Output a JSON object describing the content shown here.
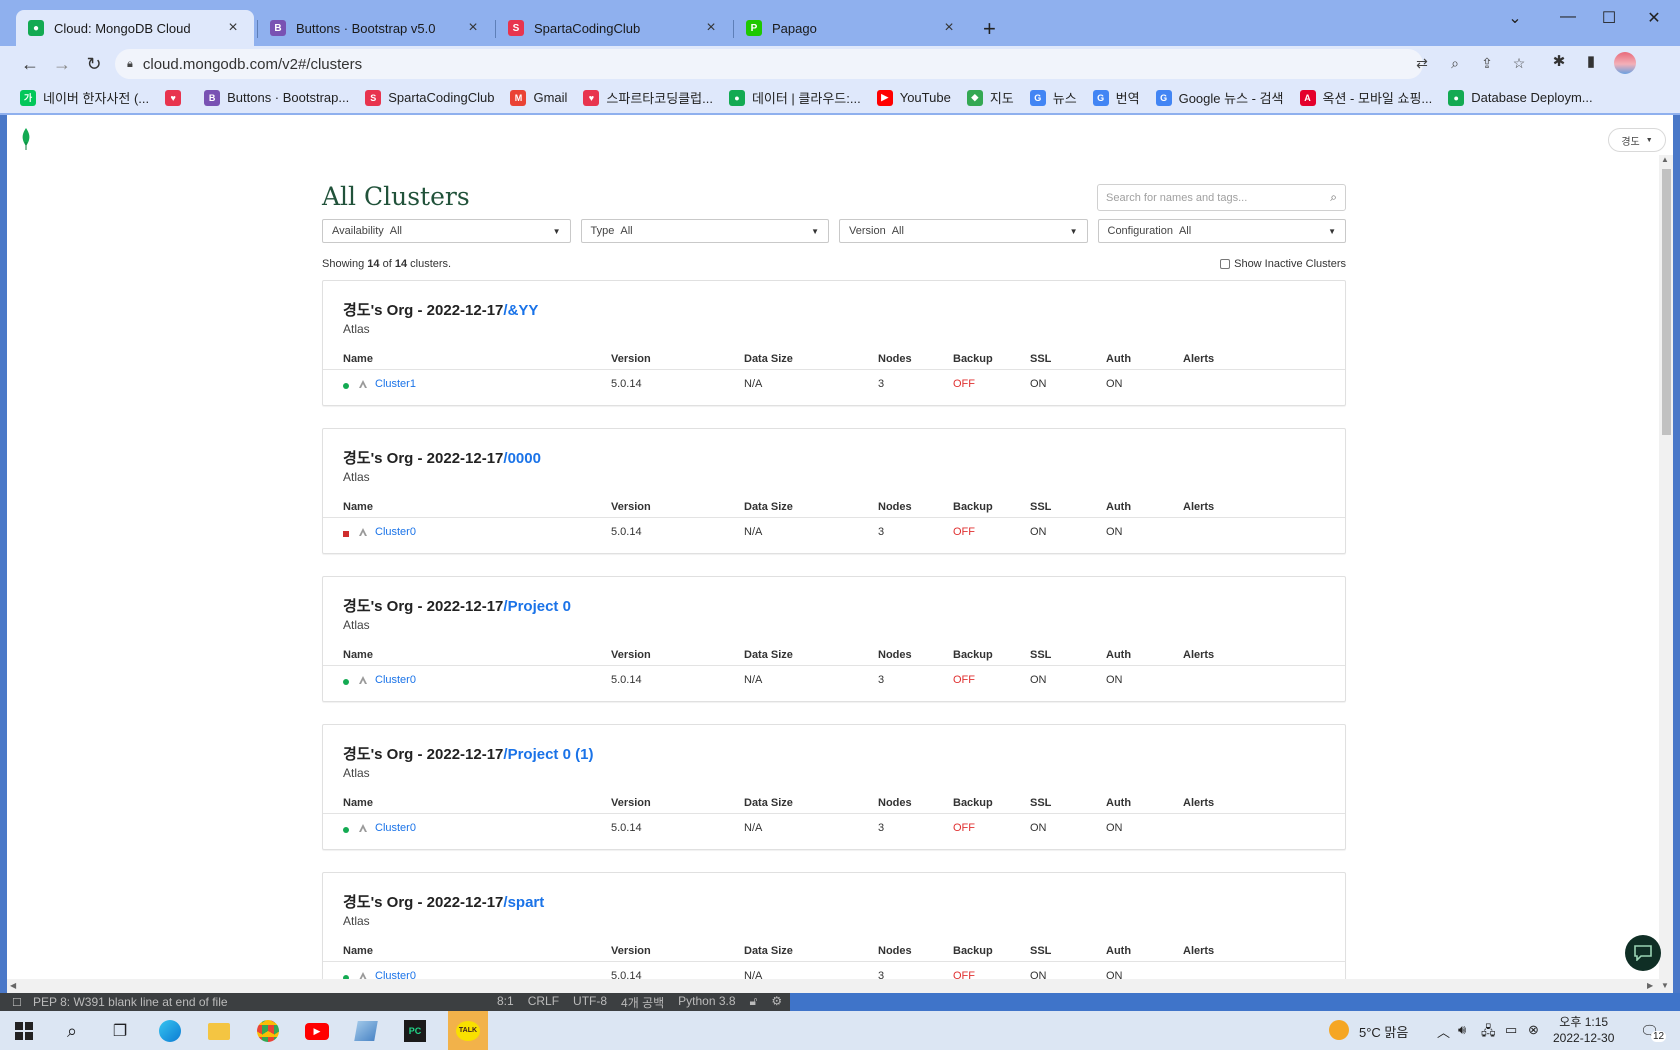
{
  "browser": {
    "tabs": [
      {
        "title": "Cloud: MongoDB Cloud",
        "favicon": "mongodb-leaf-icon",
        "color": "#13aa52",
        "active": true
      },
      {
        "title": "Buttons · Bootstrap v5.0",
        "favicon": "bootstrap-icon",
        "color": "#7952b3",
        "active": false
      },
      {
        "title": "SpartaCodingClub",
        "favicon": "sparta-icon",
        "color": "#e8344e",
        "active": false
      },
      {
        "title": "Papago",
        "favicon": "papago-icon",
        "color": "#1ec800",
        "active": false
      }
    ],
    "url": "cloud.mongodb.com/v2#/clusters",
    "bookmarks": [
      {
        "label": "네이버 한자사전 (...",
        "color": "#03c75a",
        "glyph": "가"
      },
      {
        "label": "",
        "color": "#e8344e",
        "glyph": "♥"
      },
      {
        "label": "Buttons · Bootstrap...",
        "color": "#7952b3",
        "glyph": "B"
      },
      {
        "label": "SpartaCodingClub",
        "color": "#e8344e",
        "glyph": "S"
      },
      {
        "label": "Gmail",
        "color": "#ea4335",
        "glyph": "M"
      },
      {
        "label": "스파르타코딩클럽...",
        "color": "#e8344e",
        "glyph": "♥"
      },
      {
        "label": "데이터 | 클라우드:...",
        "color": "#13aa52",
        "glyph": "●"
      },
      {
        "label": "YouTube",
        "color": "#ff0000",
        "glyph": "▶"
      },
      {
        "label": "지도",
        "color": "#34a853",
        "glyph": "◆"
      },
      {
        "label": "뉴스",
        "color": "#4285f4",
        "glyph": "G"
      },
      {
        "label": "번역",
        "color": "#4285f4",
        "glyph": "G"
      },
      {
        "label": "Google 뉴스 - 검색",
        "color": "#4285f4",
        "glyph": "G"
      },
      {
        "label": "옥션 - 모바일 쇼핑...",
        "color": "#e4002b",
        "glyph": "A"
      },
      {
        "label": "Database Deploym...",
        "color": "#13aa52",
        "glyph": "●"
      }
    ]
  },
  "page": {
    "user_menu": "경도",
    "title": "All Clusters",
    "search_placeholder": "Search for names and tags...",
    "filters": [
      {
        "label": "Availability",
        "value": "All"
      },
      {
        "label": "Type",
        "value": "All"
      },
      {
        "label": "Version",
        "value": "All"
      },
      {
        "label": "Configuration",
        "value": "All"
      }
    ],
    "showing_prefix": "Showing",
    "showing_count": "14",
    "showing_of": "of",
    "showing_total": "14",
    "showing_suffix": "clusters.",
    "show_inactive_label": "Show Inactive Clusters",
    "columns": [
      "Name",
      "Version",
      "Data Size",
      "Nodes",
      "Backup",
      "SSL",
      "Auth",
      "Alerts"
    ],
    "status_colors": {
      "active": "#13aa52",
      "paused": "#cf2e2e",
      "off": "#e03131"
    },
    "groups": [
      {
        "org": "경도's Org - 2022-12-17",
        "project": "/&YY",
        "type": "Atlas",
        "cluster": {
          "status": "active",
          "name": "Cluster1",
          "version": "5.0.14",
          "data_size": "N/A",
          "nodes": "3",
          "backup": "OFF",
          "ssl": "ON",
          "auth": "ON",
          "alerts": ""
        }
      },
      {
        "org": "경도's Org - 2022-12-17",
        "project": "/0000",
        "type": "Atlas",
        "cluster": {
          "status": "paused",
          "name": "Cluster0",
          "version": "5.0.14",
          "data_size": "N/A",
          "nodes": "3",
          "backup": "OFF",
          "ssl": "ON",
          "auth": "ON",
          "alerts": ""
        }
      },
      {
        "org": "경도's Org - 2022-12-17",
        "project": "/Project 0",
        "type": "Atlas",
        "cluster": {
          "status": "active",
          "name": "Cluster0",
          "version": "5.0.14",
          "data_size": "N/A",
          "nodes": "3",
          "backup": "OFF",
          "ssl": "ON",
          "auth": "ON",
          "alerts": ""
        }
      },
      {
        "org": "경도's Org - 2022-12-17",
        "project": "/Project 0 (1)",
        "type": "Atlas",
        "cluster": {
          "status": "active",
          "name": "Cluster0",
          "version": "5.0.14",
          "data_size": "N/A",
          "nodes": "3",
          "backup": "OFF",
          "ssl": "ON",
          "auth": "ON",
          "alerts": ""
        }
      },
      {
        "org": "경도's Org - 2022-12-17",
        "project": "/spart",
        "type": "Atlas",
        "cluster": {
          "status": "active",
          "name": "Cluster0",
          "version": "5.0.14",
          "data_size": "N/A",
          "nodes": "3",
          "backup": "OFF",
          "ssl": "ON",
          "auth": "ON",
          "alerts": ""
        }
      }
    ]
  },
  "ide_status": {
    "message": "PEP 8: W391 blank line at end of file",
    "position": "8:1",
    "line_sep": "CRLF",
    "encoding": "UTF-8",
    "indent": "4개 공백",
    "interpreter": "Python 3.8"
  },
  "taskbar": {
    "weather": "5°C 맑음",
    "time": "오후 1:15",
    "date": "2022-12-30",
    "notifications": "12"
  }
}
